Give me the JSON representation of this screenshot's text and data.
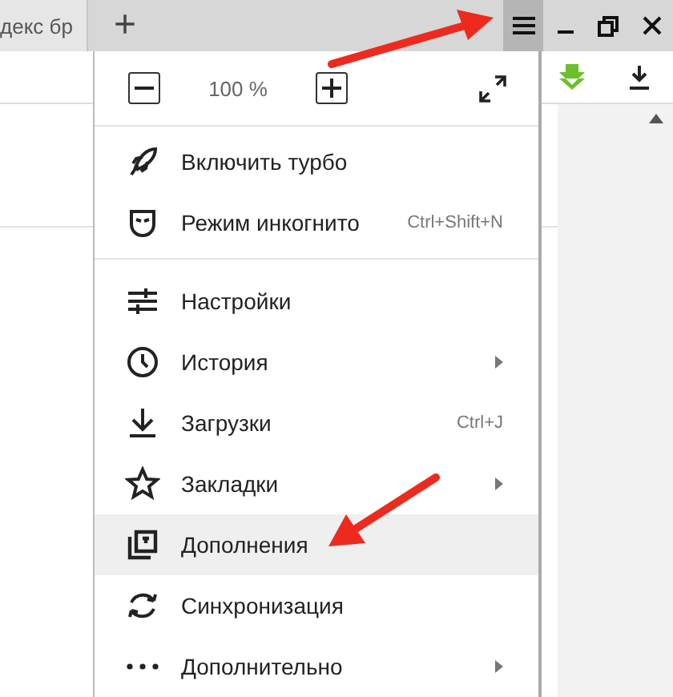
{
  "tabs": [
    {
      "title": "декс бр",
      "selected": false
    }
  ],
  "new_tab": "+",
  "menu_button": {
    "pressed": true
  },
  "menu": {
    "zoom": {
      "reading": "100 %"
    },
    "sections": [
      {
        "items": [
          {
            "label": "Включить турбо",
            "submenu": false,
            "selected": false
          },
          {
            "label": "Режим инкогнито",
            "shortcut": "Ctrl+Shift+N",
            "submenu": false,
            "selected": false
          }
        ]
      },
      {
        "items": [
          {
            "label": "Настройки",
            "submenu": false,
            "selected": false
          },
          {
            "label": "История",
            "submenu": true,
            "selected": false
          },
          {
            "label": "Загрузки",
            "shortcut": "Ctrl+J",
            "submenu": false,
            "selected": false
          },
          {
            "label": "Закладки",
            "submenu": true,
            "selected": false
          },
          {
            "label": "Дополнения",
            "submenu": false,
            "selected": true
          },
          {
            "label": "Синхронизация",
            "submenu": false,
            "selected": false
          },
          {
            "label": "Дополнительно",
            "submenu": true,
            "selected": false
          }
        ]
      }
    ]
  }
}
